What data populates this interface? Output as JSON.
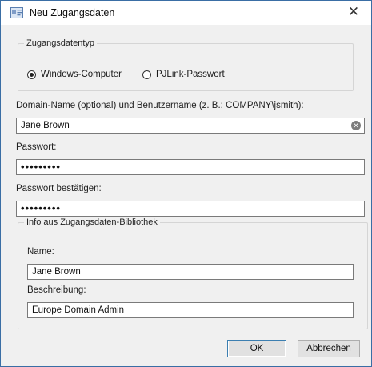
{
  "window": {
    "title": "Neu Zugangsdaten",
    "close_glyph": "✕",
    "icon": "credentials-card-icon"
  },
  "type_group": {
    "legend": "Zugangsdatentyp",
    "options": [
      {
        "label": "Windows-Computer",
        "selected": true
      },
      {
        "label": "PJLink-Passwort",
        "selected": false
      }
    ]
  },
  "domain": {
    "label": "Domain-Name (optional) und Benutzername (z. B.: COMPANY\\jsmith):",
    "value": "Jane Brown",
    "clear_glyph": "✕"
  },
  "password": {
    "label": "Passwort:",
    "value": "•••••••••"
  },
  "confirm": {
    "label": "Passwort bestätigen:",
    "value": "•••••••••"
  },
  "library": {
    "legend": "Info aus Zugangsdaten-Bibliothek",
    "name_label": "Name:",
    "name_value": "Jane Brown",
    "desc_label": "Beschreibung:",
    "desc_value": "Europe Domain Admin"
  },
  "buttons": {
    "ok": "OK",
    "cancel": "Abbrechen"
  },
  "colors": {
    "window_border": "#3a6ea5",
    "dialog_bg": "#f0f0f0",
    "default_button_border": "#3c7fb1"
  }
}
